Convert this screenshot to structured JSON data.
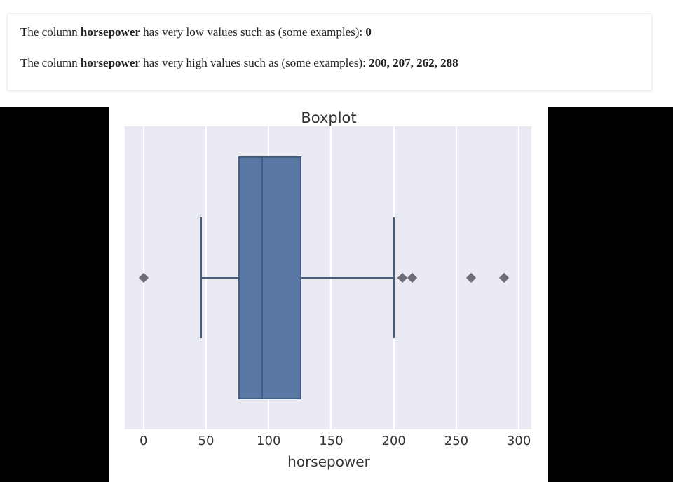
{
  "description": {
    "line1_prefix": "The column ",
    "line1_col": "horsepower",
    "line1_mid": " has very low values such as (some examples): ",
    "line1_values": "0",
    "line2_prefix": "The column ",
    "line2_col": "horsepower",
    "line2_mid": " has very high values such as (some examples): ",
    "line2_values": "200, 207, 262, 288"
  },
  "chart_data": {
    "type": "boxplot",
    "orientation": "horizontal",
    "title": "Boxplot",
    "xlabel": "horsepower",
    "x_ticks": [
      0,
      50,
      100,
      150,
      200,
      250,
      300
    ],
    "xlim": [
      -15,
      310
    ],
    "box": {
      "q1": 76,
      "median": 95,
      "q3": 126,
      "whisker_low": 46,
      "whisker_high": 200
    },
    "outliers": [
      0,
      207,
      215,
      262,
      288
    ],
    "box_color": "#5a78a5",
    "line_color": "#455d7a",
    "panel_color": "#eaeaf2",
    "grid_color": "#ffffff"
  }
}
